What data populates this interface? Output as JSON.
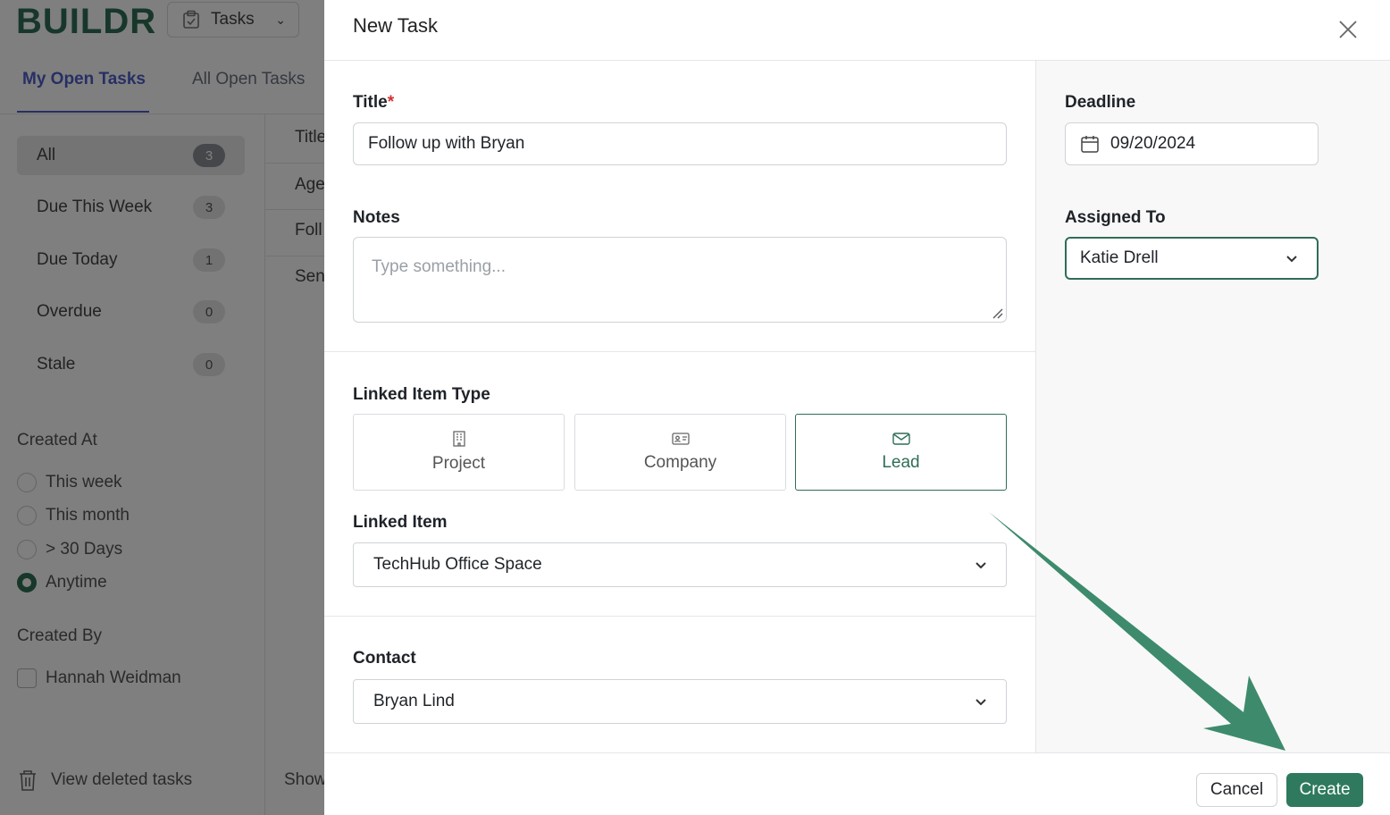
{
  "app": {
    "logo": "BUILDR",
    "module": "Tasks",
    "tabs": [
      "My Open Tasks",
      "All Open Tasks"
    ],
    "filters": [
      {
        "label": "All",
        "count": "3"
      },
      {
        "label": "Due This Week",
        "count": "3"
      },
      {
        "label": "Due Today",
        "count": "1"
      },
      {
        "label": "Overdue",
        "count": "0"
      },
      {
        "label": "Stale",
        "count": "0"
      }
    ],
    "created_at": {
      "heading": "Created At",
      "options": [
        "This week",
        "This month",
        "> 30 Days",
        "Anytime"
      ],
      "selected": "Anytime"
    },
    "created_by": {
      "heading": "Created By",
      "options": [
        "Hannah Weidman"
      ]
    },
    "view_deleted": "View deleted tasks",
    "list_fragments": [
      "Title",
      "Age",
      "Foll",
      "Sen"
    ],
    "show_fragment": "Show"
  },
  "modal": {
    "title": "New Task",
    "title_field": {
      "label": "Title",
      "required_mark": "*",
      "value": "Follow up with Bryan"
    },
    "notes_field": {
      "label": "Notes",
      "placeholder": "Type something..."
    },
    "linked_item_type": {
      "label": "Linked Item Type",
      "options": [
        {
          "label": "Project",
          "icon": "building-icon"
        },
        {
          "label": "Company",
          "icon": "id-card-icon"
        },
        {
          "label": "Lead",
          "icon": "envelope-icon"
        }
      ],
      "selected": "Lead"
    },
    "linked_item": {
      "label": "Linked Item",
      "value": "TechHub Office Space"
    },
    "contact": {
      "label": "Contact",
      "value": "Bryan Lind"
    },
    "deadline": {
      "label": "Deadline",
      "value": "09/20/2024"
    },
    "assigned_to": {
      "label": "Assigned To",
      "value": "Katie Drell"
    },
    "buttons": {
      "cancel": "Cancel",
      "create": "Create"
    }
  },
  "colors": {
    "brand_green": "#2f6e55",
    "create_button": "#2f7a5e",
    "annotation_arrow": "#3d8b6c",
    "active_tab": "#4f5fc9"
  }
}
